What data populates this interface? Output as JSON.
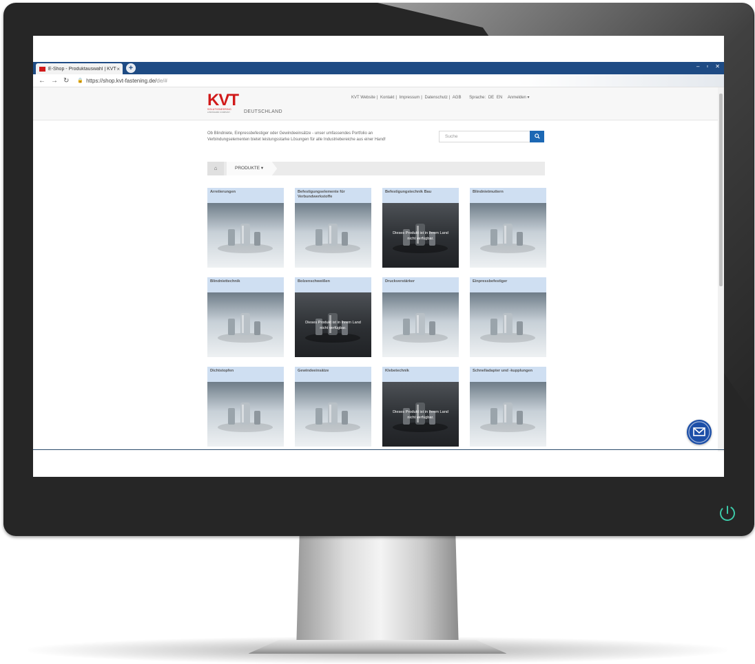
{
  "browser": {
    "tab_title": "E-Shop - Produktauswahl | KVT-",
    "tab_close": "×",
    "new_tab": "+",
    "window_controls": [
      "–",
      "▫",
      "✕"
    ],
    "url_main": "https://shop.kvt-fastening.de/",
    "url_dim": "de/#"
  },
  "header": {
    "logo_text": "KVT",
    "logo_tagline": "SOLUTIONEERING",
    "logo_subtagline": "A BOSSARD COMPANY",
    "country": "DEUTSCHLAND",
    "nav_links": [
      "KVT Website",
      "Kontakt",
      "Impressum",
      "Datenschutz",
      "AGB"
    ],
    "language_label": "Sprache:",
    "languages": [
      "DE",
      "EN"
    ],
    "login_label": "Anmelden ▾"
  },
  "intro_text": "Ob Blindniete, Einpressbefestiger oder Gewindeeinsätze - unser umfassendes Portfolio an Verbindungselementen bietet leistungsstarke Lösungen für alle Industriebereiche aus einer Hand!",
  "search": {
    "placeholder": "Suche"
  },
  "breadcrumb": {
    "products_label": "PRODUKTE ▾"
  },
  "unavailable_note": "Dieses Produkt ist in Ihrem Land nicht verfügbar.",
  "products": [
    {
      "title": "Arretierungen",
      "unavailable": false,
      "tone": "light"
    },
    {
      "title": "Befestigungselemente für Verbundwerkstoffe",
      "unavailable": false,
      "tone": "light"
    },
    {
      "title": "Befestigungstechnik Bau",
      "unavailable": true,
      "tone": "dark"
    },
    {
      "title": "Blindnietmuttern",
      "unavailable": false,
      "tone": "light"
    },
    {
      "title": "Blindniettechnik",
      "unavailable": false,
      "tone": "light"
    },
    {
      "title": "Bolzenschweißen",
      "unavailable": true,
      "tone": "dark"
    },
    {
      "title": "Druckverstärker",
      "unavailable": false,
      "tone": "light"
    },
    {
      "title": "Einpressbefestiger",
      "unavailable": false,
      "tone": "light"
    },
    {
      "title": "Dichtstopfen",
      "unavailable": false,
      "tone": "light"
    },
    {
      "title": "Gewindeeinsätze",
      "unavailable": false,
      "tone": "light"
    },
    {
      "title": "Klebetechnik",
      "unavailable": true,
      "tone": "dark"
    },
    {
      "title": "Schnelladapter und -kupplungen",
      "unavailable": false,
      "tone": "light"
    }
  ],
  "colors": {
    "brand_red": "#d11a1a",
    "accent_blue": "#1c68b4",
    "card_title_bg": "#cfdff2",
    "tab_bar": "#1e4b84"
  }
}
